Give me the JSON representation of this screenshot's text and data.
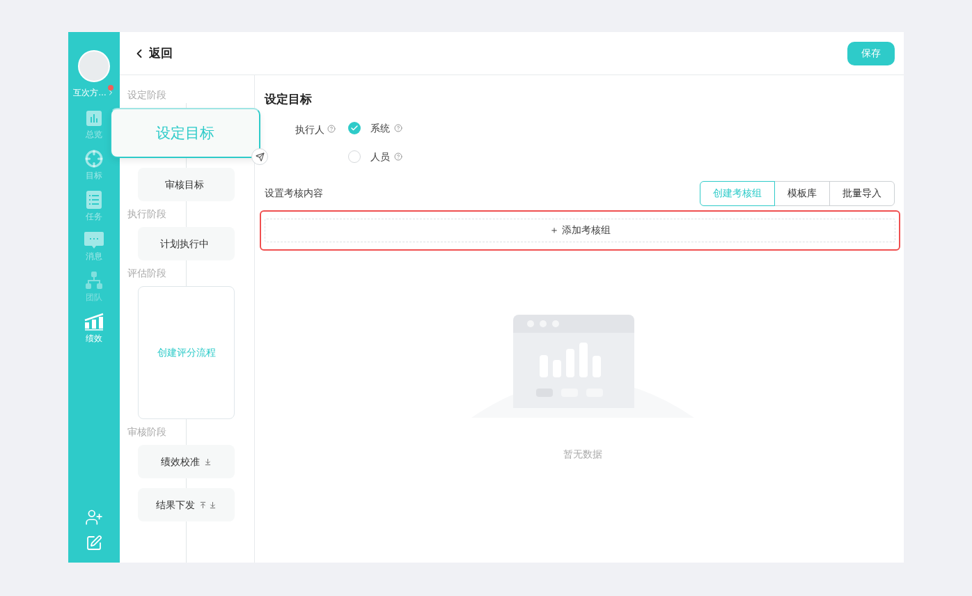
{
  "header": {
    "back_label": "返回",
    "save_label": "保存"
  },
  "sidebar": {
    "user_name": "互次方…",
    "has_notification": true,
    "items": [
      {
        "label": "总览",
        "selected": false
      },
      {
        "label": "目标",
        "selected": false
      },
      {
        "label": "任务",
        "selected": false
      },
      {
        "label": "消息",
        "selected": false
      },
      {
        "label": "团队",
        "selected": false,
        "disabled": true
      },
      {
        "label": "绩效",
        "selected": true
      }
    ]
  },
  "flow": [
    {
      "stage": "设定阶段",
      "nodes": [
        {
          "text": "设定目标",
          "kind": "active",
          "sort_up": false,
          "sort_down": false
        },
        {
          "text": "审核目标",
          "kind": "step",
          "sort_up": false,
          "sort_down": false
        }
      ]
    },
    {
      "stage": "执行阶段",
      "nodes": [
        {
          "text": "计划执行中",
          "kind": "step",
          "sort_up": false,
          "sort_down": false
        }
      ]
    },
    {
      "stage": "评估阶段",
      "nodes": [
        {
          "text": "创建评分流程",
          "kind": "create",
          "sort_up": false,
          "sort_down": false
        }
      ]
    },
    {
      "stage": "审核阶段",
      "nodes": [
        {
          "text": "绩效校准",
          "kind": "step",
          "sort_up": false,
          "sort_down": true
        },
        {
          "text": "结果下发",
          "kind": "step",
          "sort_up": true,
          "sort_down": true
        }
      ]
    }
  ],
  "content": {
    "title": "设定目标",
    "executor_label": "执行人",
    "executor_options": [
      {
        "label": "系统",
        "selected": true
      },
      {
        "label": "人员",
        "selected": false
      }
    ],
    "section_label": "设置考核内容",
    "tabs": [
      {
        "label": "创建考核组",
        "selected": true
      },
      {
        "label": "模板库",
        "selected": false
      },
      {
        "label": "批量导入",
        "selected": false
      }
    ],
    "add_group_label": "＋ 添加考核组",
    "empty_text": "暂无数据"
  }
}
